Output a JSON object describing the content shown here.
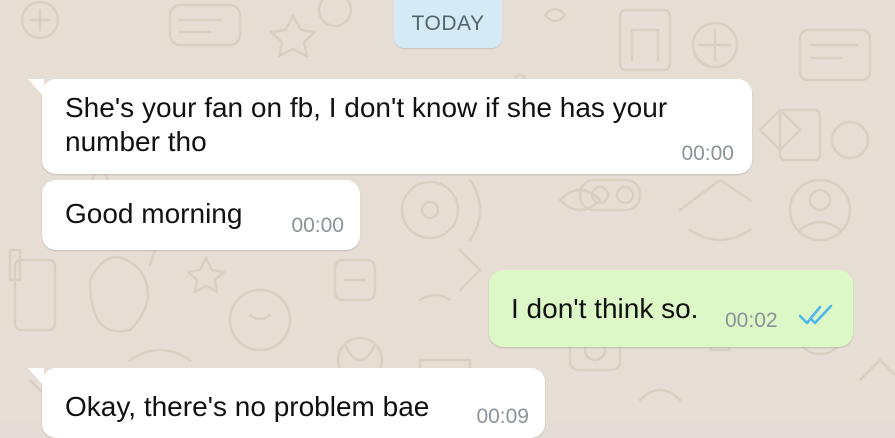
{
  "date_divider": "TODAY",
  "messages": [
    {
      "direction": "incoming",
      "line1": "She's your fan on fb, I don't know if she has your",
      "line2": "number tho",
      "time": "00:00"
    },
    {
      "direction": "incoming",
      "text": "Good morning",
      "time": "00:00"
    },
    {
      "direction": "outgoing",
      "text": "I don't think so.",
      "time": "00:02",
      "status": "read"
    },
    {
      "direction": "incoming",
      "text": "Okay, there's no problem bae",
      "time": "00:09"
    }
  ],
  "colors": {
    "background": "#e6ded4",
    "incoming_bubble": "#ffffff",
    "outgoing_bubble": "#dcf8c6",
    "date_chip": "#d4eaf4",
    "read_ticks": "#4fb6ec",
    "timestamp": "#8a9399"
  },
  "icons": [
    "double-check-read-icon"
  ]
}
